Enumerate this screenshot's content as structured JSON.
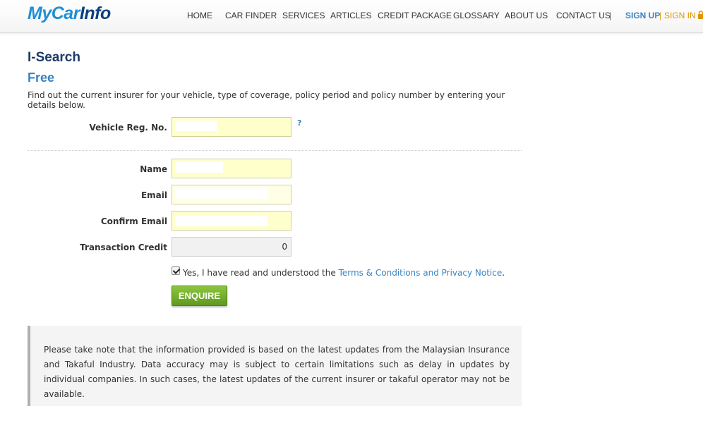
{
  "brand": {
    "part1": "My",
    "part2": "Car",
    "part3": "Info"
  },
  "nav": {
    "items": [
      "HOME",
      "CAR FINDER",
      "SERVICES",
      "ARTICLES",
      "CREDIT PACKAGE",
      "GLOSSARY",
      "ABOUT US",
      "CONTACT US"
    ],
    "separator": "|",
    "sign_up": "SIGN UP",
    "auth_separator": "|",
    "sign_in": "SIGN IN"
  },
  "page": {
    "title": "I-Search",
    "subtitle": "Free",
    "description": "Find out the current insurer for your vehicle, type of coverage, policy period and policy number by entering your details below."
  },
  "form": {
    "vehicle_reg_label": "Vehicle Reg. No.",
    "vehicle_reg_value": "",
    "help": "?",
    "name_label": "Name",
    "name_value": "",
    "email_label": "Email",
    "email_value": "",
    "confirm_email_label": "Confirm Email",
    "confirm_email_value": "",
    "credit_label": "Transaction Credit",
    "credit_value": "0",
    "agree_checked": true,
    "agree_text": "Yes, I have read and understood the ",
    "agree_link": "Terms & Conditions and Privacy Notice",
    "agree_end": ".",
    "submit": "ENQUIRE"
  },
  "notice": "Please take note that the information provided is based on the latest updates from the Malaysian Insurance and Takaful Industry. Data accuracy may is subject to certain limitations such as delay in updates by individual companies. In such cases, the latest updates of the current insurer or takaful operator may not be available.",
  "colors": {
    "brand_blue": "#1f90d6",
    "brand_navy": "#0b3f82",
    "link": "#3a84c4",
    "sign_in": "#e09400",
    "button_green": "#6fae2c",
    "field_yellow": "#ffffcc"
  },
  "icons": [
    "lock-icon",
    "checkbox-checked-icon",
    "help-icon"
  ]
}
